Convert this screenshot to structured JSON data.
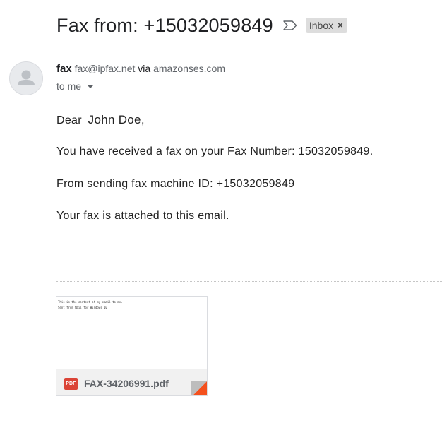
{
  "email": {
    "subject": "Fax from: +15032059849",
    "label": "Inbox",
    "label_close": "×"
  },
  "sender": {
    "name": "fax",
    "address": "fax@ipfax.net",
    "via_label": "via",
    "via_domain": "amazonses.com",
    "recipient": "to me"
  },
  "body": {
    "greeting_prefix": "Dear",
    "greeting_name": "John Doe,",
    "line1": "You have received a fax on your Fax Number: 15032059849.",
    "line2": "From sending fax machine ID: +15032059849",
    "line3": "Your fax is attached to this email."
  },
  "attachment": {
    "file_name": "FAX-34206991.pdf",
    "type_badge": "PDF",
    "preview_line1": "This is the content of my email to me.",
    "preview_line2": "Sent from Mail for Windows 10"
  },
  "colors": {
    "pdf_badge": "#db4437",
    "fold_accent": "#f4511e"
  },
  "icons": {
    "importance": "importance-marker-icon",
    "avatar": "default-user-avatar-icon",
    "dropdown": "caret-down-icon",
    "file_type": "pdf-icon"
  }
}
